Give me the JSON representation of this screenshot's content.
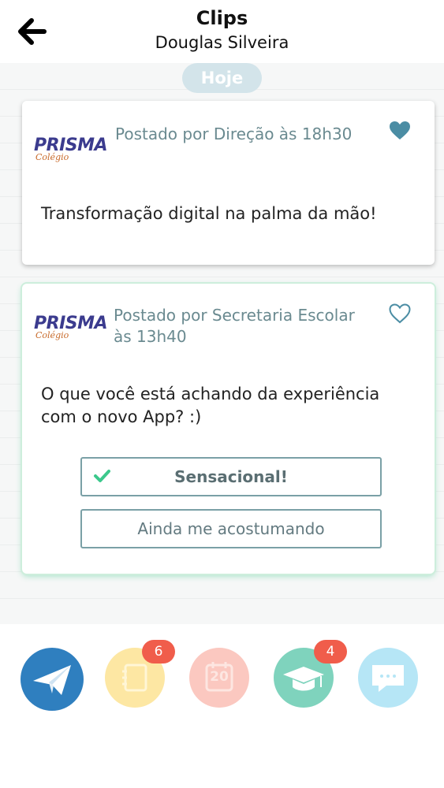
{
  "header": {
    "title": "Clips",
    "subtitle": "Douglas Silveira"
  },
  "feed": {
    "date_label": "Hoje"
  },
  "posts": [
    {
      "logo": {
        "brand": "PRISMA",
        "sub": "Colégio"
      },
      "meta": "Postado por Direção às 18h30",
      "text": "Transformação digital na palma da mão!",
      "liked": true
    },
    {
      "logo": {
        "brand": "PRISMA",
        "sub": "Colégio"
      },
      "meta_line1": "Postado por Secretaria Escolar",
      "meta_line2": "às 13h40",
      "text_line1": "O que você está achando da experiência",
      "text_line2": "com o novo App? :)",
      "liked": false,
      "options": [
        {
          "label": "Sensacional!",
          "selected": true
        },
        {
          "label": "Ainda me acostumando",
          "selected": false
        }
      ]
    }
  ],
  "nav": {
    "items": [
      {
        "icon": "send-icon",
        "color": "#2f7fbf"
      },
      {
        "icon": "notebook-icon",
        "color": "#fde7a3",
        "badge": "6"
      },
      {
        "icon": "calendar-icon",
        "color": "#fbc8c0",
        "label": "20"
      },
      {
        "icon": "graduation-cap-icon",
        "color": "#7fd3bd",
        "badge": "4"
      },
      {
        "icon": "chat-icon",
        "color": "#b6e6f6"
      }
    ]
  },
  "colors": {
    "accent_green": "#3cc88c",
    "badge_red": "#f05d4b",
    "meta_text": "#6a8a90"
  }
}
